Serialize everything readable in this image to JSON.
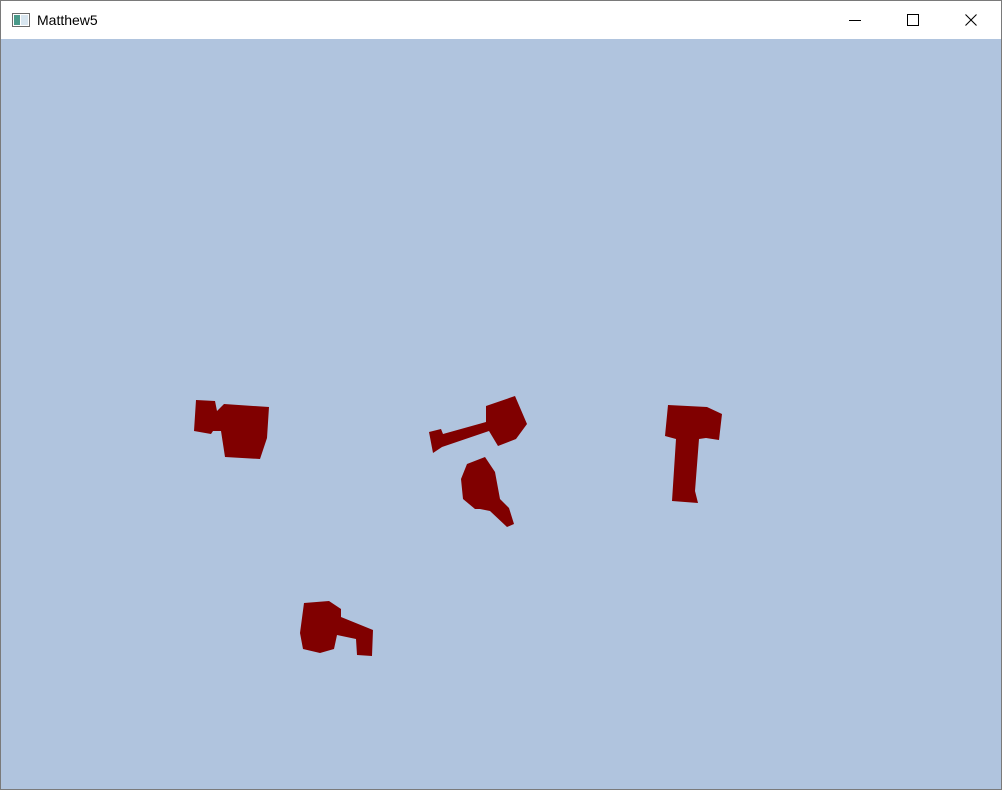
{
  "window": {
    "title": "Matthew5"
  },
  "icons": {
    "app": "app-window-icon",
    "minimize": "minimize-icon",
    "maximize": "maximize-icon",
    "close": "close-icon"
  },
  "colors": {
    "background": "#b0c4de",
    "object": "#800000",
    "titlebar": "#ffffff"
  },
  "scene": {
    "objects": [
      {
        "name": "hammer-1"
      },
      {
        "name": "hammer-2"
      },
      {
        "name": "hammer-3"
      },
      {
        "name": "hammer-4"
      },
      {
        "name": "hammer-5"
      }
    ]
  }
}
